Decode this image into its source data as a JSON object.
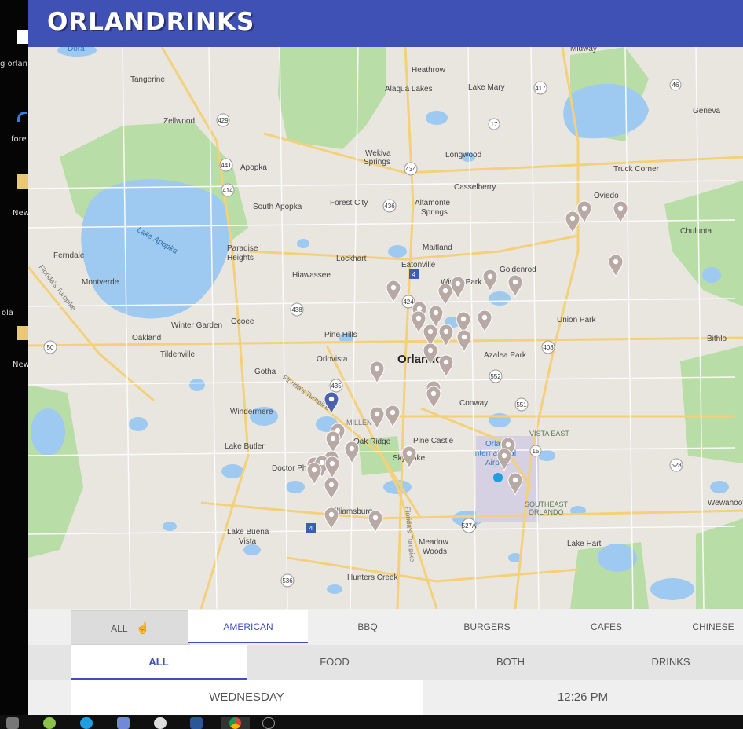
{
  "app": {
    "brand": "ORLANDRINKS"
  },
  "desktop": {
    "icons": [
      {
        "label": "g orlan"
      },
      {
        "label": "fore"
      },
      {
        "label": "New"
      },
      {
        "label": "ola"
      },
      {
        "label": "New"
      }
    ]
  },
  "map": {
    "city_label": "Orlando",
    "places": {
      "dora": "Dora",
      "midway": "Midway",
      "tangerine": "Tangerine",
      "heathrow": "Heathrow",
      "alaqua": "Alaqua Lakes",
      "lake_mary": "Lake Mary",
      "geneva": "Geneva",
      "zellwood": "Zellwood",
      "wekiva": "Wekiva",
      "springs": "Springs",
      "longwood": "Longwood",
      "apopka": "Apopka",
      "truck_corner": "Truck Corner",
      "casselberry": "Casselberry",
      "oviedo": "Oviedo",
      "altamonte": "Altamonte",
      "altamonte_springs": "Springs",
      "south_apopka": "South Apopka",
      "forest_city": "Forest City",
      "chuluota": "Chuluota",
      "lake_apopka": "Lake Apopka",
      "paradise1": "Paradise",
      "paradise2": "Heights",
      "ferndale": "Ferndale",
      "lockhart": "Lockhart",
      "maitland": "Maitland",
      "goldenrod": "Goldenrod",
      "eatonville": "Eatonville",
      "montverde": "Montverde",
      "hiawassee": "Hiawassee",
      "winter_park": "Winter Park",
      "winter_garden": "Winter Garden",
      "ocoee": "Ocoee",
      "union_park": "Union Park",
      "oakland": "Oakland",
      "pine_hills": "Pine Hills",
      "bithlo": "Bithlo",
      "tildenville": "Tildenville",
      "orlovista": "Orlovista",
      "azalea_park": "Azalea Park",
      "gotha": "Gotha",
      "conway": "Conway",
      "windermere": "Windermere",
      "oak_ridge": "Oak Ridge",
      "vista_east": "VISTA EAST",
      "pine_castle": "Pine Castle",
      "lake_butler": "Lake Butler",
      "orlando_intl1": "Orlando",
      "orlando_intl2": "International",
      "orlando_intl3": "Airport",
      "sky_lake": "Sky Lake",
      "doctor_phillips": "Doctor Phillips",
      "wewahootee": "Wewahootee",
      "southeast1": "SOUTHEAST",
      "southeast2": "ORLANDO",
      "williamsburg": "Williamsburg",
      "lake_buena1": "Lake Buena",
      "lake_buena2": "Vista",
      "meadow1": "Meadow",
      "meadow2": "Woods",
      "lake_hart": "Lake Hart",
      "hunters_creek": "Hunters Creek",
      "fl_turnpike": "Florida's Turnpike",
      "millenia": "MILLEN"
    },
    "roads": [
      "46",
      "429",
      "417",
      "17",
      "441",
      "414",
      "434",
      "436",
      "424",
      "4",
      "50",
      "438",
      "408",
      "552",
      "551",
      "15",
      "528",
      "435",
      "527A",
      "536",
      "4"
    ]
  },
  "categories": {
    "items": [
      {
        "label": "ALL"
      },
      {
        "label": "AMERICAN"
      },
      {
        "label": "BBQ"
      },
      {
        "label": "BURGERS"
      },
      {
        "label": "CAFES"
      },
      {
        "label": "CHINESE"
      }
    ],
    "active": "AMERICAN"
  },
  "types": {
    "items": [
      {
        "label": "ALL"
      },
      {
        "label": "FOOD"
      },
      {
        "label": "BOTH"
      },
      {
        "label": "DRINKS"
      }
    ],
    "active": "ALL"
  },
  "when": {
    "day": "WEDNESDAY",
    "time": "12:26 PM"
  },
  "colors": {
    "brand": "#3f51b5",
    "pin": "#b8a9a5",
    "pin_selected": "#4a62b0",
    "water": "#9ec9f0",
    "park": "#b6dca2",
    "road": "#f6d47a"
  }
}
